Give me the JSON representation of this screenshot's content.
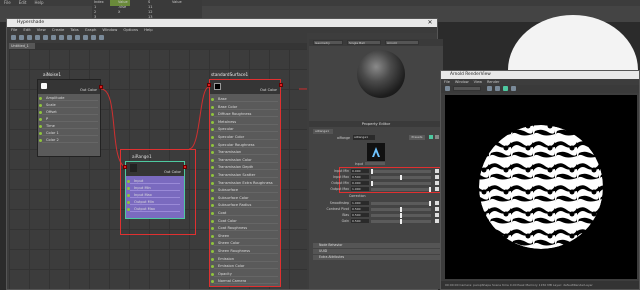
{
  "top": {
    "menu": [
      "File",
      "Edit",
      "Help"
    ],
    "table_cols": [
      "Index",
      "Value",
      "S",
      "Value"
    ],
    "rows": [
      [
        "Index",
        "",
        ""
      ],
      [
        "1",
        ".vlse",
        "11"
      ],
      [
        "2",
        "X",
        "12"
      ],
      [
        "3",
        "",
        "13"
      ]
    ]
  },
  "hypershade": {
    "title": "Hypershade",
    "menu": [
      "File",
      "Edit",
      "View",
      "Create",
      "Tabs",
      "Graph",
      "Window",
      "Options",
      "Help"
    ],
    "tab": "Untitled_1"
  },
  "nodes": {
    "aiNoise": {
      "title": "aiNoise1",
      "out": "Out Color",
      "attrs": [
        "Amplitude",
        "Scale",
        "Offset",
        "P",
        "Time",
        "Color 1",
        "Color 2"
      ]
    },
    "aiRange": {
      "title": "aiRange1",
      "out": "Out Color",
      "attrs": [
        "Input",
        "Input Min",
        "Input Max",
        "Output Min",
        "Output Max"
      ]
    },
    "std": {
      "title": "standardSurface1",
      "out": "Out Color",
      "attrs": [
        "Base",
        "Base Color",
        "Diffuse Roughness",
        "Metalness",
        "Specular",
        "Specular Color",
        "Specular Roughness",
        "Transmission",
        "Transmission Color",
        "Transmission Depth",
        "Transmission Scatter",
        "Transmission Extra Roughness",
        "Subsurface",
        "Subsurface Color",
        "Subsurface Radius",
        "Coat",
        "Coat Color",
        "Coat Roughness",
        "Sheen",
        "Sheen Color",
        "Sheen Roughness",
        "Emission",
        "Emission Color",
        "Opacity",
        "Normal Camera"
      ]
    }
  },
  "sample": {
    "dd1": "Geometry",
    "dd2": "Single Ball",
    "dd3": "Arnold"
  },
  "prop": {
    "title": "Property Editor",
    "node_tab": "aiRange1",
    "node_label": "aiRange",
    "presets": "Presets",
    "input_label": "Input",
    "rows": [
      {
        "label": "Input Min",
        "value": "0.000"
      },
      {
        "label": "Input Max",
        "value": "0.500"
      },
      {
        "label": "Output Min",
        "value": "0.000"
      },
      {
        "label": "Output Max",
        "value": "1.000"
      }
    ],
    "correct_label": "Correction",
    "rows2": [
      {
        "label": "Smoothstep",
        "value": "1.000"
      },
      {
        "label": "Contrast Pivot",
        "value": "0.500"
      },
      {
        "label": "Bias",
        "value": "0.500"
      },
      {
        "label": "Gain",
        "value": "0.500"
      }
    ],
    "sections": [
      "Node Behavior",
      "UUID",
      "Extra Attributes"
    ]
  },
  "render": {
    "title": "Arnold RenderView",
    "menu": [
      "File",
      "Window",
      "View",
      "Render"
    ],
    "status": "00:00:00  Camera: perspShape  Scene time 0.00  Peak Memory 1150 MB  Layer: defaultRenderLayer"
  },
  "colors": {
    "accent_node": "#4ec9a0",
    "highlight": "#e03030",
    "port": "#8fc43d"
  }
}
